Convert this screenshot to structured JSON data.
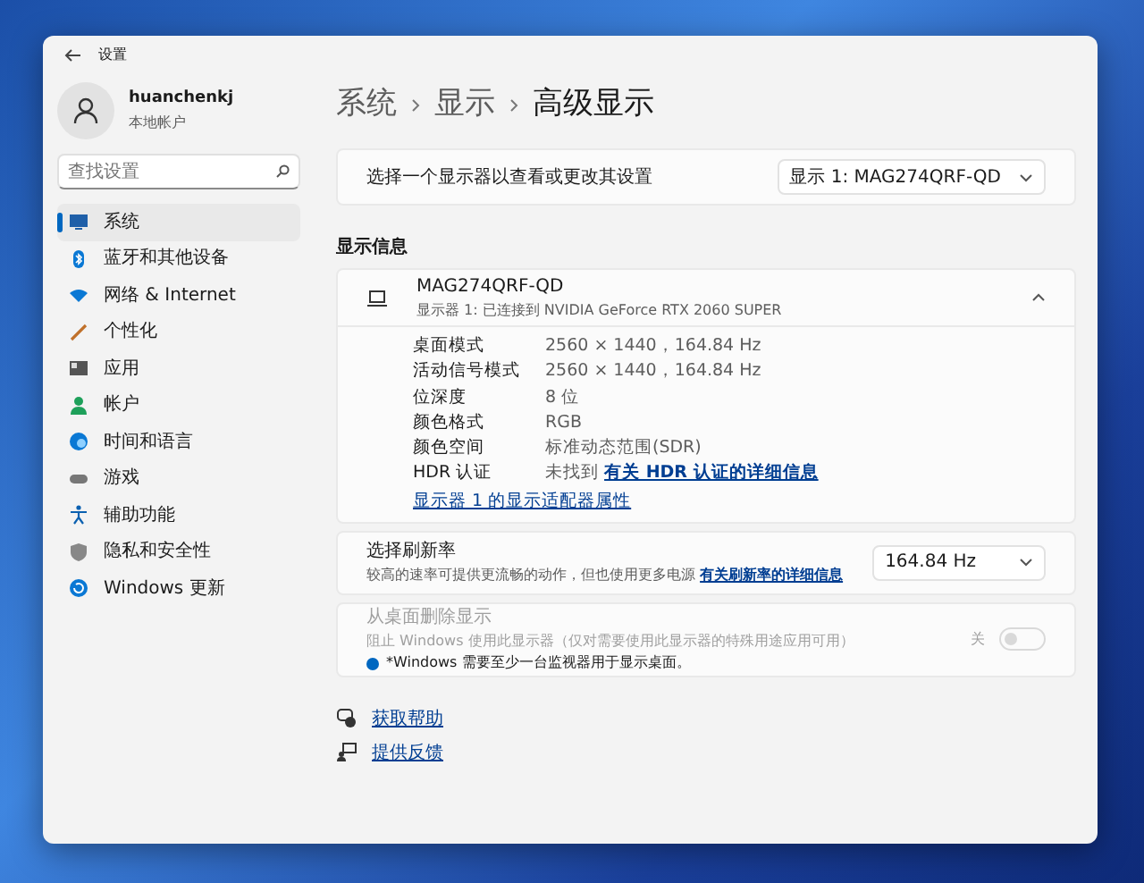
{
  "window": {
    "title": "设置"
  },
  "profile": {
    "name": "huanchenkj",
    "account": "本地帐户"
  },
  "search": {
    "placeholder": "查找设置"
  },
  "sidebar": {
    "items": [
      {
        "label": "系统",
        "selected": true
      },
      {
        "label": "蓝牙和其他设备",
        "selected": false
      },
      {
        "label": "网络 & Internet",
        "selected": false
      },
      {
        "label": "个性化",
        "selected": false
      },
      {
        "label": "应用",
        "selected": false
      },
      {
        "label": "帐户",
        "selected": false
      },
      {
        "label": "时间和语言",
        "selected": false
      },
      {
        "label": "游戏",
        "selected": false
      },
      {
        "label": "辅助功能",
        "selected": false
      },
      {
        "label": "隐私和安全性",
        "selected": false
      },
      {
        "label": "Windows 更新",
        "selected": false
      }
    ]
  },
  "breadcrumb": [
    "系统",
    "显示",
    "高级显示"
  ],
  "display_selector": {
    "label": "选择一个显示器以查看或更改其设置",
    "value": "显示 1: MAG274QRF-QD"
  },
  "section_title": "显示信息",
  "display_card": {
    "name": "MAG274QRF-QD",
    "subtitle": "显示器 1: 已连接到 NVIDIA GeForce RTX 2060 SUPER",
    "expanded": true,
    "rows": [
      {
        "label": "桌面模式",
        "value": "2560 × 1440，164.84 Hz"
      },
      {
        "label": "活动信号模式",
        "value": "2560 × 1440，164.84 Hz"
      },
      {
        "label": "位深度",
        "value": "8 位"
      },
      {
        "label": "颜色格式",
        "value": "RGB"
      },
      {
        "label": "颜色空间",
        "value": "标准动态范围(SDR)"
      },
      {
        "label": "HDR 认证",
        "value": "未找到",
        "link": "有关 HDR 认证的详细信息"
      }
    ],
    "adapter_link": "显示器 1 的显示适配器属性"
  },
  "refresh": {
    "title": "选择刷新率",
    "description": "较高的速率可提供更流畅的动作，但也使用更多电源",
    "link": "有关刷新率的详细信息",
    "value": "164.84 Hz"
  },
  "remove_display": {
    "title": "从桌面删除显示",
    "description": "阻止 Windows 使用此显示器（仅对需要使用此显示器的特殊用途应用可用）",
    "note": "*Windows 需要至少一台监视器用于显示桌面。",
    "toggle_label": "关",
    "on": false,
    "disabled": true
  },
  "help_links": [
    "获取帮助",
    "提供反馈"
  ]
}
